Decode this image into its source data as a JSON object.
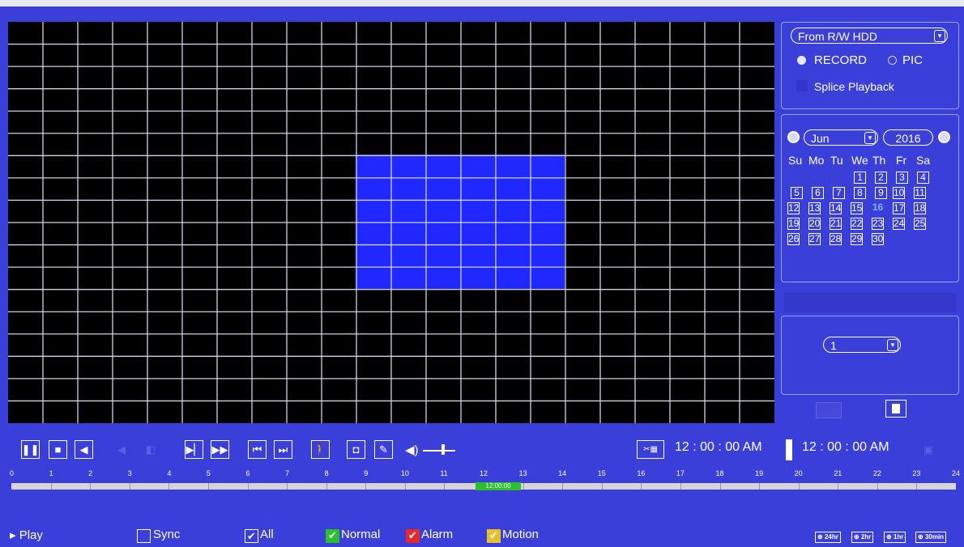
{
  "source": {
    "value": "From R/W HDD",
    "dropdown_icon": "chevron-down-icon"
  },
  "mode": {
    "record_label": "RECORD",
    "pic_label": "PIC",
    "selected": "RECORD"
  },
  "splice_label": "Splice Playback",
  "calendar": {
    "month": "Jun",
    "year": "2016",
    "weekdays": [
      "Su",
      "Mo",
      "Tu",
      "We",
      "Th",
      "Fr",
      "Sa"
    ],
    "today": "16",
    "days": [
      "1",
      "2",
      "3",
      "4",
      "5",
      "6",
      "7",
      "8",
      "9",
      "10",
      "11",
      "12",
      "13",
      "14",
      "15",
      "16",
      "17",
      "18",
      "19",
      "20",
      "21",
      "22",
      "23",
      "24",
      "25",
      "26",
      "27",
      "28",
      "29",
      "30"
    ]
  },
  "channel": {
    "value": "1"
  },
  "controls": {
    "start_time": "12 : 00 : 00 AM",
    "end_time": "12 : 00 : 00 AM",
    "buttons": [
      "pause-icon",
      "stop-icon",
      "reverse-play-icon",
      "slow-play-icon",
      "fast-forward-icon",
      "previous-file-icon",
      "next-file-icon",
      "smart-search-icon",
      "snapshot-icon",
      "mark-icon",
      "volume-icon"
    ]
  },
  "timeline": {
    "hours": [
      "0",
      "1",
      "2",
      "3",
      "4",
      "5",
      "6",
      "7",
      "8",
      "9",
      "10",
      "11",
      "12",
      "13",
      "14",
      "15",
      "16",
      "17",
      "18",
      "19",
      "20",
      "21",
      "22",
      "23",
      "24"
    ],
    "recorded_label": "12:00:00"
  },
  "bottom": {
    "play_label": "Play",
    "sync_label": "Sync",
    "all_label": "All",
    "normal_label": "Normal",
    "alarm_label": "Alarm",
    "motion_label": "Motion",
    "zoom": [
      "24hr",
      "2hr",
      "1hr",
      "30min"
    ]
  },
  "colors": {
    "background": "#3b3fd9",
    "motion_region": "#1f28ff",
    "normal": "#2ac02a",
    "alarm": "#e52a2a",
    "motion": "#e5c02a"
  }
}
